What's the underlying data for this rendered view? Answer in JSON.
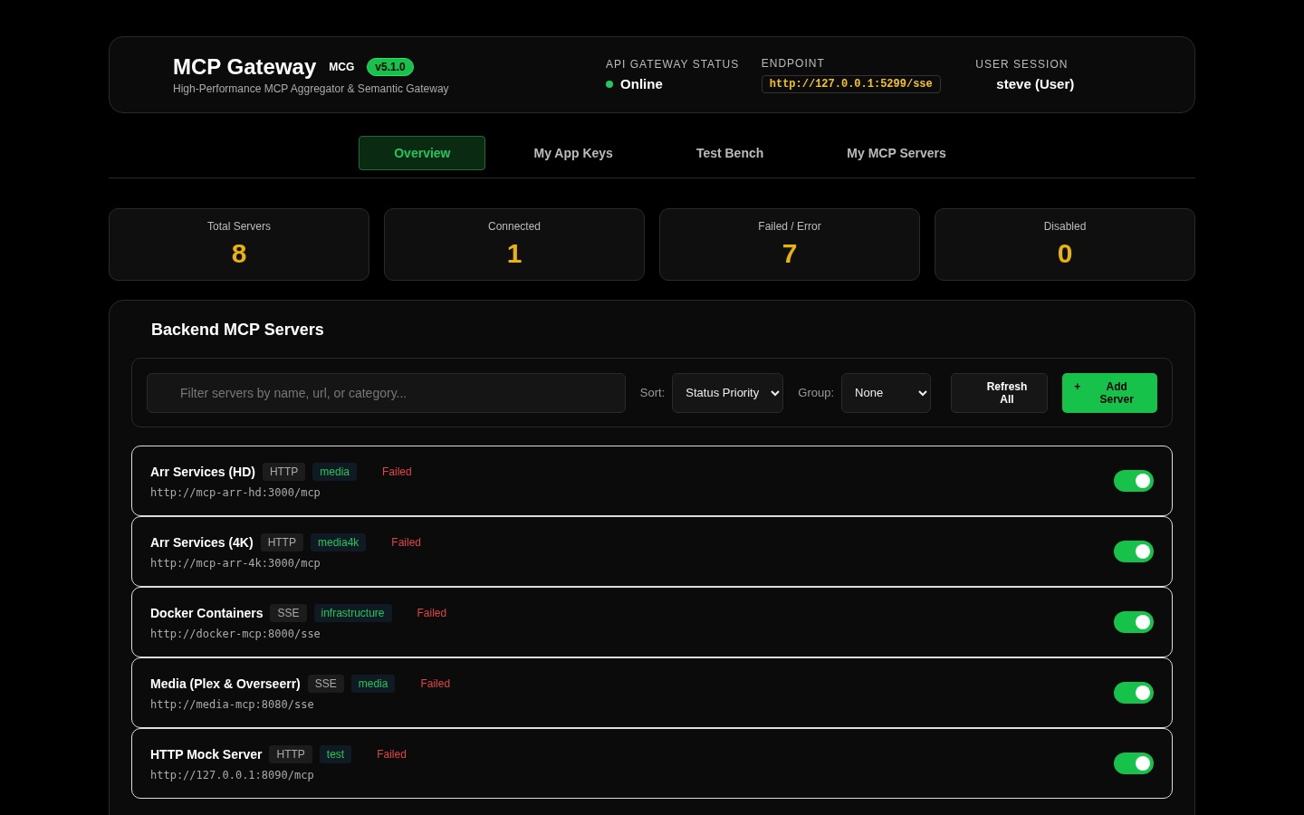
{
  "header": {
    "title": "MCP Gateway",
    "abbr": "MCG",
    "version": "v5.1.0",
    "subtitle": "High-Performance MCP Aggregator & Semantic Gateway",
    "status": {
      "label": "API GATEWAY STATUS",
      "value": "Online",
      "online": true
    },
    "endpoint": {
      "label": "ENDPOINT",
      "value": "http://127.0.0.1:5299/sse"
    },
    "session": {
      "label": "USER SESSION",
      "value": "steve (User)"
    }
  },
  "tabs": [
    {
      "label": "Overview",
      "selected": true
    },
    {
      "label": "My App Keys",
      "selected": false
    },
    {
      "label": "Test Bench",
      "selected": false
    },
    {
      "label": "My MCP Servers",
      "selected": false
    }
  ],
  "stats": [
    {
      "label": "Total Servers",
      "value": "8"
    },
    {
      "label": "Connected",
      "value": "1"
    },
    {
      "label": "Failed / Error",
      "value": "7"
    },
    {
      "label": "Disabled",
      "value": "0"
    }
  ],
  "panel": {
    "title": "Backend MCP Servers",
    "filter": {
      "placeholder": "Filter servers by name, url, or category..."
    },
    "sort": {
      "label": "Sort:",
      "value": "Status Priority"
    },
    "group": {
      "label": "Group:",
      "value": "None"
    },
    "refresh": "Refresh All",
    "add": {
      "icon": "+",
      "label": "Add Server"
    }
  },
  "servers": [
    {
      "name": "Arr Services (HD)",
      "protocol": "HTTP",
      "category": "media",
      "status": "Failed",
      "url": "http://mcp-arr-hd:3000/mcp",
      "enabled": true
    },
    {
      "name": "Arr Services (4K)",
      "protocol": "HTTP",
      "category": "media4k",
      "status": "Failed",
      "url": "http://mcp-arr-4k:3000/mcp",
      "enabled": true
    },
    {
      "name": "Docker Containers",
      "protocol": "SSE",
      "category": "infrastructure",
      "status": "Failed",
      "url": "http://docker-mcp:8000/sse",
      "enabled": true
    },
    {
      "name": "Media (Plex & Overseerr)",
      "protocol": "SSE",
      "category": "media",
      "status": "Failed",
      "url": "http://media-mcp:8080/sse",
      "enabled": true
    },
    {
      "name": "HTTP Mock Server",
      "protocol": "HTTP",
      "category": "test",
      "status": "Failed",
      "url": "http://127.0.0.1:8090/mcp",
      "enabled": true
    }
  ]
}
